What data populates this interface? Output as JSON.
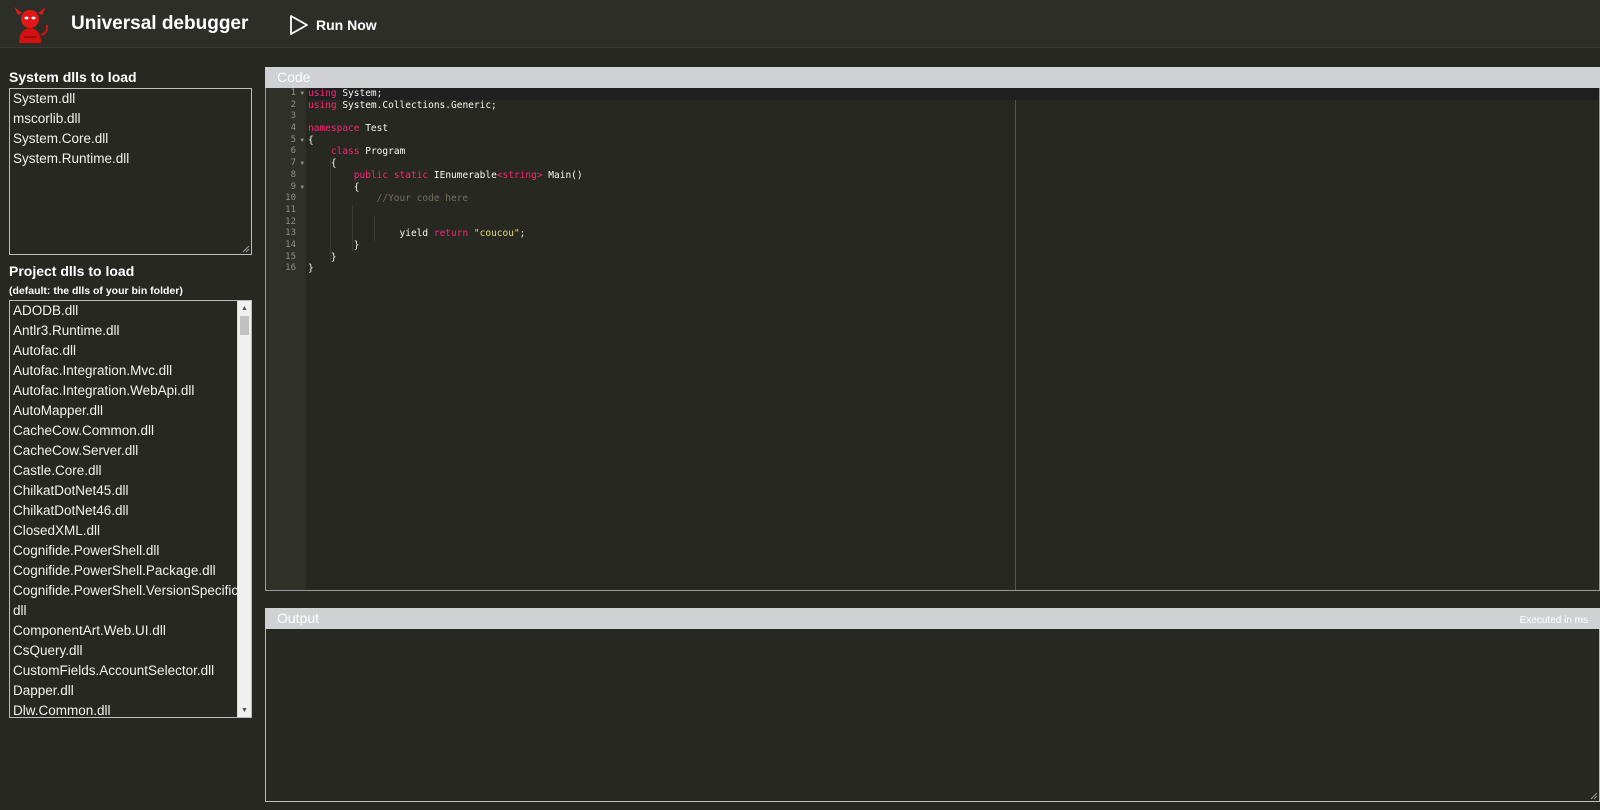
{
  "header": {
    "title": "Universal debugger",
    "run_label": "Run Now"
  },
  "sidebar": {
    "system_title": "System dlls to load",
    "system_dlls": [
      "System.dll",
      "mscorlib.dll",
      "System.Core.dll",
      "System.Runtime.dll"
    ],
    "project_title": "Project dlls to load",
    "project_subtitle": "(default: the dlls of your bin folder)",
    "project_dlls": [
      "ADODB.dll",
      "Antlr3.Runtime.dll",
      "Autofac.dll",
      "Autofac.Integration.Mvc.dll",
      "Autofac.Integration.WebApi.dll",
      "AutoMapper.dll",
      "CacheCow.Common.dll",
      "CacheCow.Server.dll",
      "Castle.Core.dll",
      "ChilkatDotNet45.dll",
      "ChilkatDotNet46.dll",
      "ClosedXML.dll",
      "Cognifide.PowerShell.dll",
      "Cognifide.PowerShell.Package.dll",
      "Cognifide.PowerShell.VersionSpecific.",
      "dll",
      "ComponentArt.Web.UI.dll",
      "CsQuery.dll",
      "CustomFields.AccountSelector.dll",
      "Dapper.dll",
      "Dlw.Common.dll"
    ]
  },
  "code": {
    "title": "Code",
    "line_numbers": [
      "1",
      "2",
      "3",
      "4",
      "5",
      "6",
      "7",
      "8",
      "9",
      "10",
      "11",
      "12",
      "13",
      "14",
      "15",
      "16"
    ],
    "lines": {
      "l1_kw": "using",
      "l1_rest": " System;",
      "l2_kw": "using",
      "l2_rest": " System.Collections.Generic;",
      "l4_kw": "namespace",
      "l4_rest": " Test",
      "l5": "{",
      "l6_kw": "class",
      "l6_rest": " Program",
      "l7": "{",
      "l8_kw1": "public",
      "l8_kw2": "static",
      "l8_type": "IEnumerable",
      "l8_generic": "<string>",
      "l8_rest": " Main()",
      "l9": "{",
      "l10_comment": "//Your code here",
      "l13_a": "yield ",
      "l13_kw": "return",
      "l13_str": "\"coucou\"",
      "l13_end": ";",
      "l14": "}",
      "l15": "}",
      "l16": "}"
    }
  },
  "output": {
    "title": "Output",
    "exec_time": "Executed in ms"
  },
  "colors": {
    "background": "#272822",
    "keyword": "#f92672",
    "string": "#e6db74",
    "comment": "#75715e",
    "panel_header": "#d0d1d3"
  }
}
